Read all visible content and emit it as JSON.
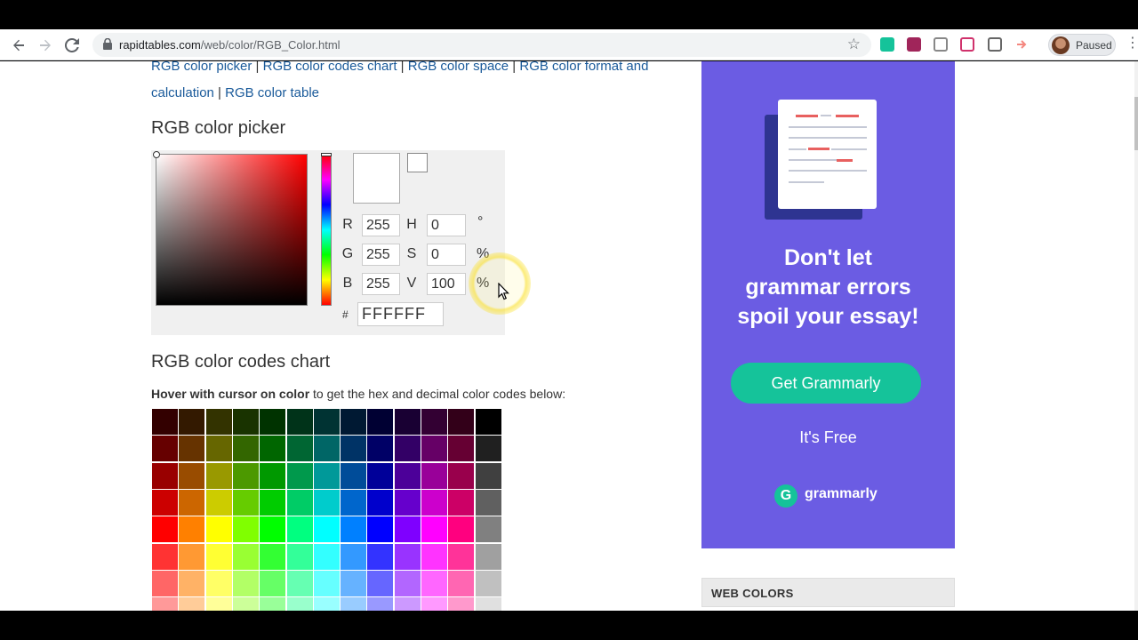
{
  "browser": {
    "url_domain": "rapidtables.com",
    "url_path": "/web/color/RGB_Color.html",
    "profile_status": "Paused"
  },
  "page": {
    "nav_links": [
      {
        "label": "RGB color picker"
      },
      {
        "label": "RGB color codes chart"
      },
      {
        "label": "RGB color space"
      },
      {
        "label": "RGB color format and calculation"
      },
      {
        "label": "RGB color table"
      }
    ],
    "separator": " | ",
    "picker_heading": "RGB color picker",
    "picker": {
      "r_label": "R",
      "r_value": "255",
      "g_label": "G",
      "g_value": "255",
      "b_label": "B",
      "b_value": "255",
      "h_label": "H",
      "h_value": "0",
      "h_unit": "°",
      "s_label": "S",
      "s_value": "0",
      "s_unit": "%",
      "v_label": "V",
      "v_value": "100",
      "v_unit": "%",
      "hash_label": "#",
      "hex_value": "FFFFFF",
      "selected_color": "#FFFFFF"
    },
    "chart_heading": "RGB color codes chart",
    "chart_note_bold": "Hover with cursor on color",
    "chart_note_rest": " to get the hex and decimal color codes below:",
    "color_grid": [
      [
        "#330000",
        "#331900",
        "#333300",
        "#193300",
        "#003300",
        "#003319",
        "#003333",
        "#001933",
        "#000033",
        "#190033",
        "#330033",
        "#330019",
        "#000000"
      ],
      [
        "#660000",
        "#663300",
        "#666600",
        "#336600",
        "#006600",
        "#006633",
        "#006666",
        "#003366",
        "#000066",
        "#330066",
        "#660066",
        "#660033",
        "#202020"
      ],
      [
        "#990000",
        "#994C00",
        "#999900",
        "#4C9900",
        "#009900",
        "#00994C",
        "#009999",
        "#004C99",
        "#000099",
        "#4C0099",
        "#990099",
        "#99004C",
        "#404040"
      ],
      [
        "#CC0000",
        "#CC6600",
        "#CCCC00",
        "#66CC00",
        "#00CC00",
        "#00CC66",
        "#00CCCC",
        "#0066CC",
        "#0000CC",
        "#6600CC",
        "#CC00CC",
        "#CC0066",
        "#606060"
      ],
      [
        "#FF0000",
        "#FF8000",
        "#FFFF00",
        "#80FF00",
        "#00FF00",
        "#00FF80",
        "#00FFFF",
        "#0080FF",
        "#0000FF",
        "#7F00FF",
        "#FF00FF",
        "#FF007F",
        "#808080"
      ],
      [
        "#FF3333",
        "#FF9933",
        "#FFFF33",
        "#99FF33",
        "#33FF33",
        "#33FF99",
        "#33FFFF",
        "#3399FF",
        "#3333FF",
        "#9933FF",
        "#FF33FF",
        "#FF3399",
        "#A0A0A0"
      ],
      [
        "#FF6666",
        "#FFB266",
        "#FFFF66",
        "#B2FF66",
        "#66FF66",
        "#66FFB2",
        "#66FFFF",
        "#66B2FF",
        "#6666FF",
        "#B266FF",
        "#FF66FF",
        "#FF66B2",
        "#C0C0C0"
      ],
      [
        "#FF9999",
        "#FFCC99",
        "#FFFF99",
        "#CCFF99",
        "#99FF99",
        "#99FFCC",
        "#99FFFF",
        "#99CCFF",
        "#9999FF",
        "#CC99FF",
        "#FF99FF",
        "#FF99CC",
        "#E0E0E0"
      ]
    ]
  },
  "ad": {
    "background": "#6B5CE3",
    "headline": [
      "Don't let",
      "grammar errors",
      "spoil your essay!"
    ],
    "cta": "Get Grammarly",
    "sub": "It's Free",
    "brand": "grammarly",
    "brand_mark": "G",
    "accent": "#15C39A"
  },
  "sidebar": {
    "web_colors_heading": "WEB COLORS"
  }
}
